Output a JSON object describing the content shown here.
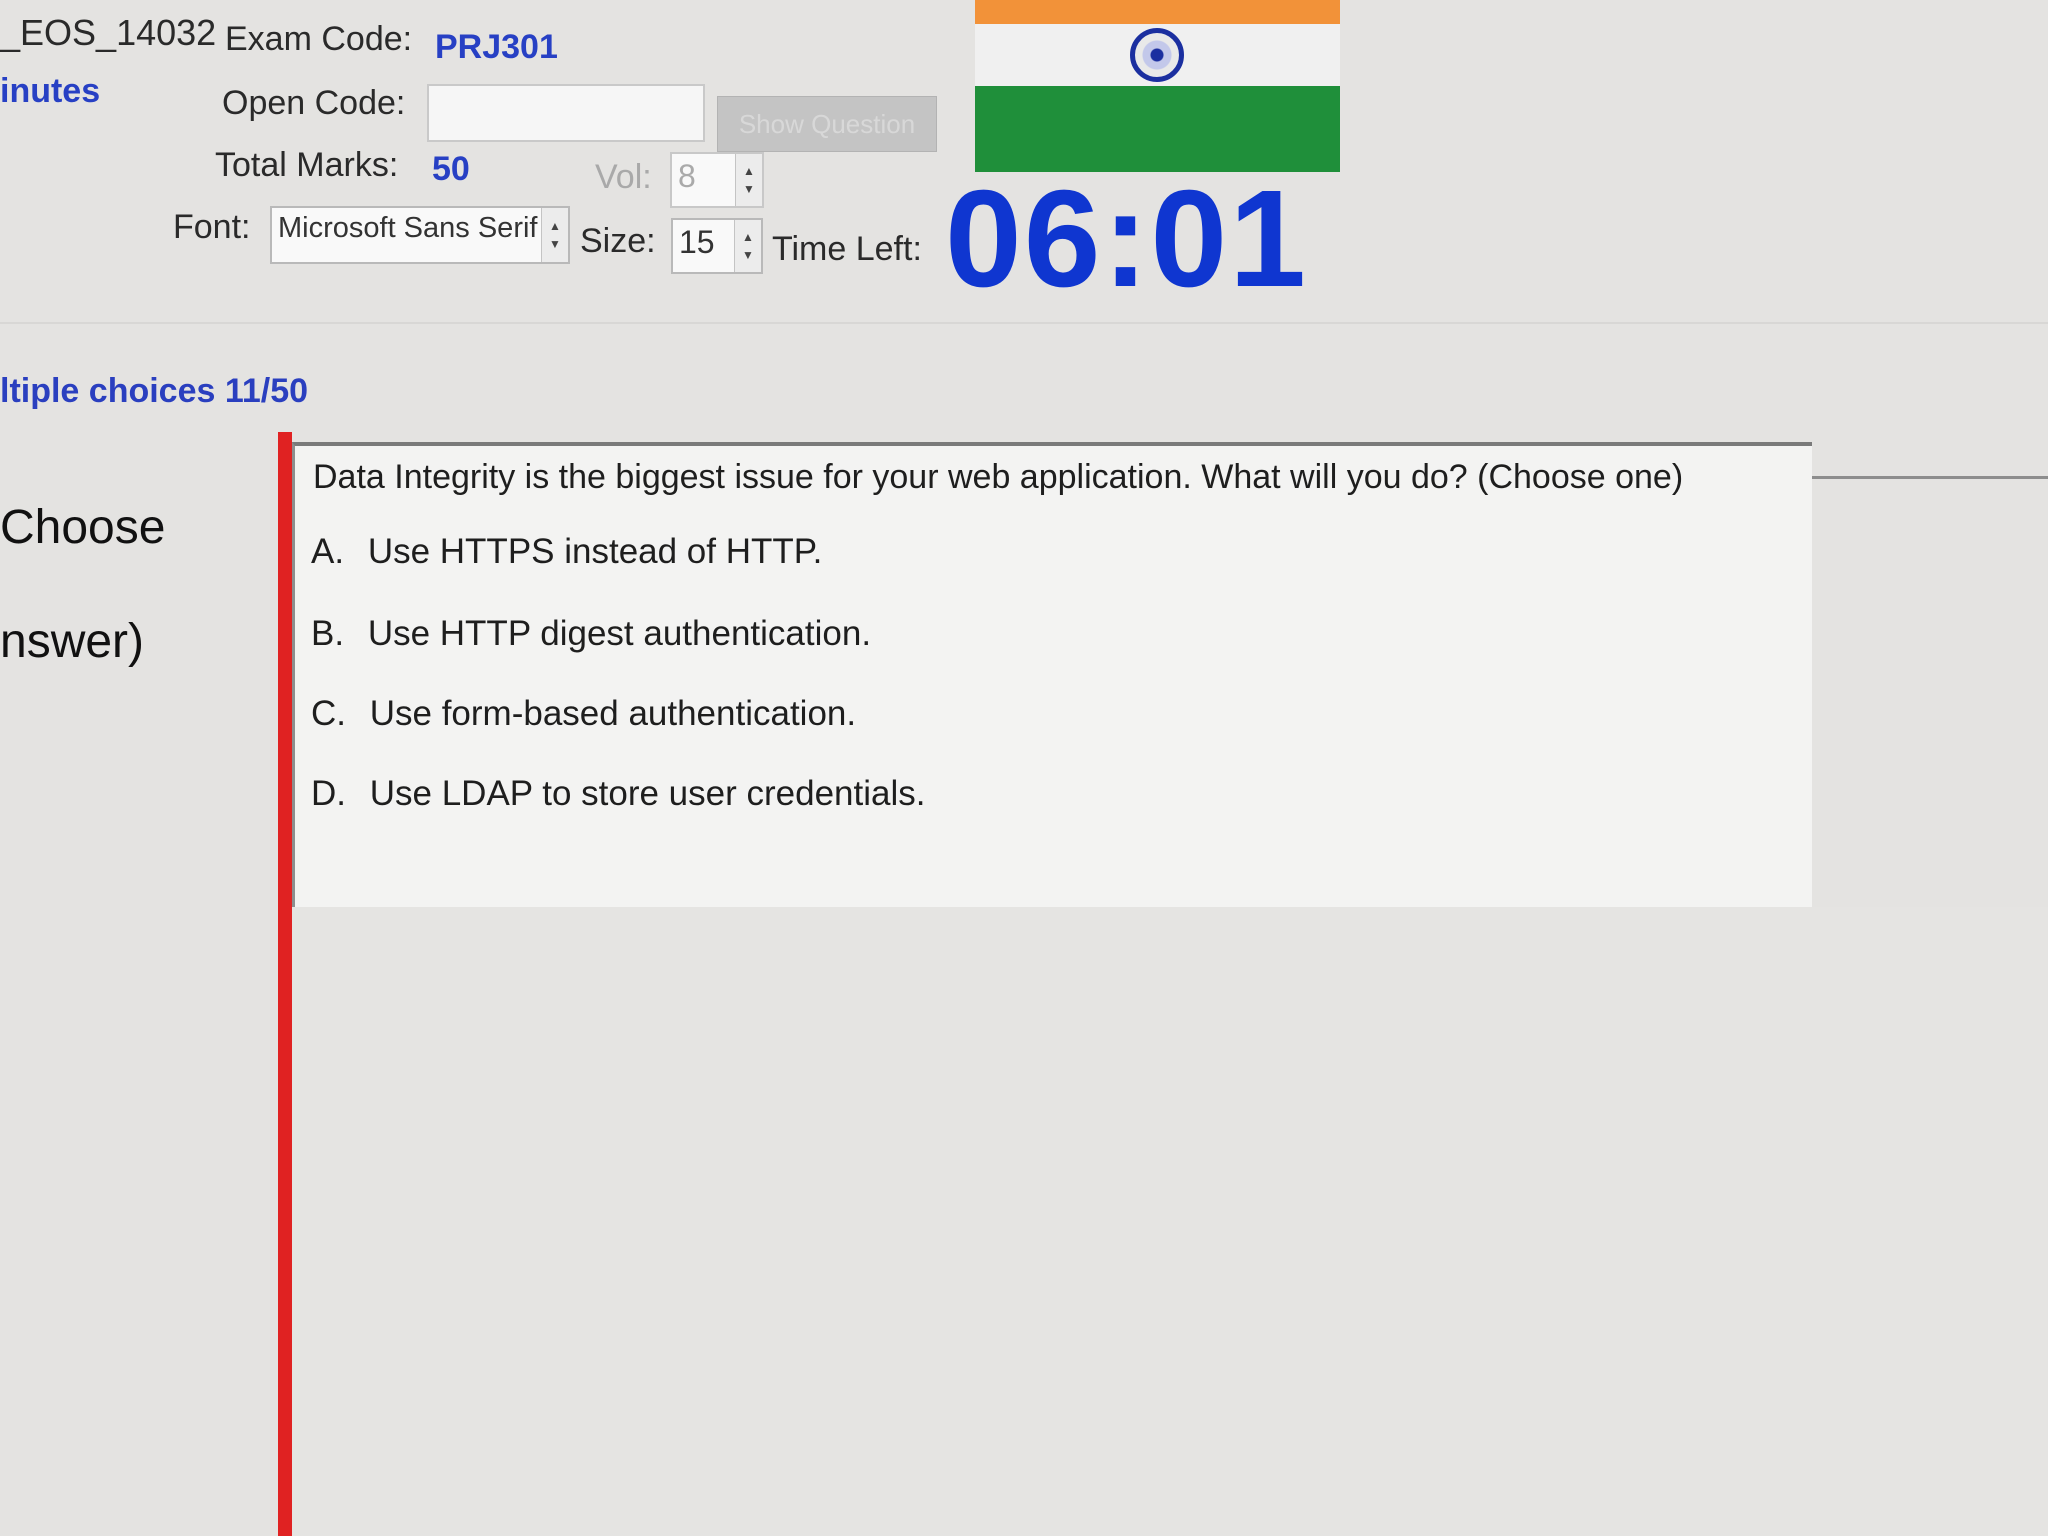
{
  "header": {
    "exam_id": "_EOS_14032",
    "exam_code_label": "Exam Code:",
    "exam_code": "PRJ301",
    "duration_fragment": "inutes",
    "open_code_label": "Open Code:",
    "open_code_value": "",
    "show_question_label": "Show Question",
    "total_marks_label": "Total Marks:",
    "total_marks": "50",
    "vol_label": "Vol:",
    "vol_value": "8",
    "font_label": "Font:",
    "font_value": "Microsoft Sans Serif",
    "size_label": "Size:",
    "size_value": "15",
    "time_left_label": "Time Left:",
    "time_left": "06:01"
  },
  "flag": {
    "colors": [
      "#f29239",
      "#f0f0f0",
      "#1f8f3a"
    ],
    "emblem": "ashoka-chakra-icon"
  },
  "section": {
    "title": "ltiple choices 11/50"
  },
  "left": {
    "line1": "Choose",
    "line2": "nswer)"
  },
  "question": {
    "text": "Data Integrity is the biggest issue for your web application. What will you do? (Choose one)",
    "options": [
      {
        "letter": "A.",
        "text": "Use HTTPS instead of HTTP."
      },
      {
        "letter": "B.",
        "text": "Use HTTP digest authentication."
      },
      {
        "letter": "C.",
        "text": "Use form-based authentication."
      },
      {
        "letter": "D.",
        "text": "Use LDAP to store user credentials."
      }
    ]
  },
  "colors": {
    "accent_blue": "#2740c4",
    "timer_blue": "#0f36d0",
    "red_bar": "#e02222"
  }
}
